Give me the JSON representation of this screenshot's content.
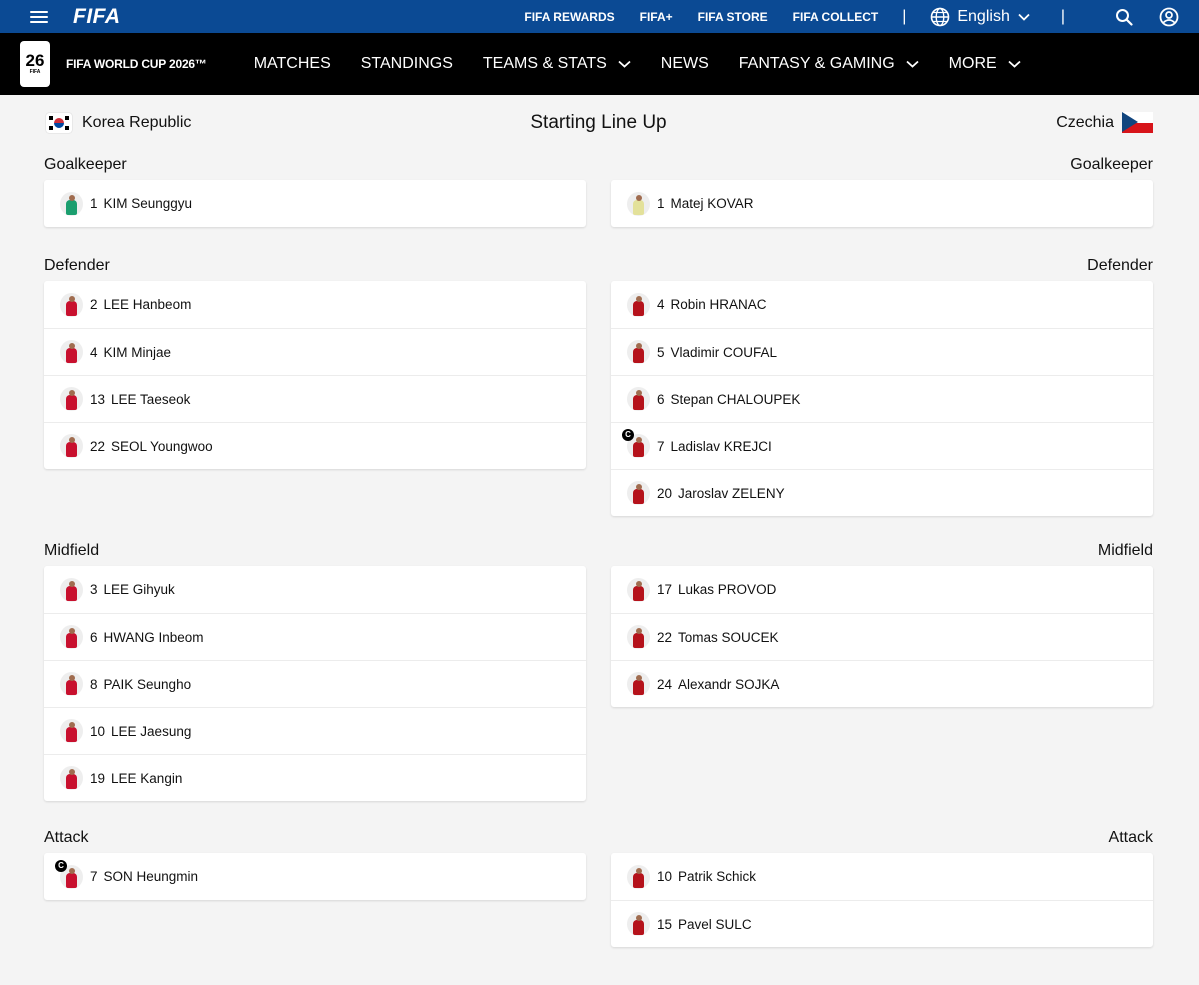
{
  "topbar": {
    "logo": "FIFA",
    "links": [
      "FIFA REWARDS",
      "FIFA+",
      "FIFA STORE",
      "FIFA COLLECT"
    ],
    "separator": "|",
    "language": "English",
    "icons": [
      "menu-icon",
      "globe-icon",
      "chevron-down-icon",
      "search-icon",
      "user-icon"
    ]
  },
  "navbar": {
    "logo_text": "FIFA WORLD CUP 2026™",
    "logo_num": "26",
    "logo_tag": "FIFA",
    "items": [
      {
        "label": "MATCHES",
        "dropdown": false
      },
      {
        "label": "STANDINGS",
        "dropdown": false
      },
      {
        "label": "TEAMS & STATS",
        "dropdown": true
      },
      {
        "label": "NEWS",
        "dropdown": false
      },
      {
        "label": "FANTASY & GAMING",
        "dropdown": true
      },
      {
        "label": "MORE",
        "dropdown": true
      }
    ]
  },
  "lineup": {
    "title": "Starting Line Up",
    "home_team": "Korea Republic",
    "away_team": "Czechia",
    "captain_badge": "C",
    "home_color": "#c8102e",
    "away_color": "#b5121b",
    "home_gk_color": "#1a9e6e",
    "away_gk_color": "#e3e19a",
    "sections": [
      {
        "label": "Goalkeeper",
        "home": [
          {
            "num": "1",
            "name": "KIM Seunggyu",
            "captain": false
          }
        ],
        "away": [
          {
            "num": "1",
            "name": "Matej KOVAR",
            "captain": false
          }
        ]
      },
      {
        "label": "Defender",
        "home": [
          {
            "num": "2",
            "name": "LEE Hanbeom",
            "captain": false
          },
          {
            "num": "4",
            "name": "KIM Minjae",
            "captain": false
          },
          {
            "num": "13",
            "name": "LEE Taeseok",
            "captain": false
          },
          {
            "num": "22",
            "name": "SEOL Youngwoo",
            "captain": false
          }
        ],
        "away": [
          {
            "num": "4",
            "name": "Robin HRANAC",
            "captain": false
          },
          {
            "num": "5",
            "name": "Vladimir COUFAL",
            "captain": false
          },
          {
            "num": "6",
            "name": "Stepan CHALOUPEK",
            "captain": false
          },
          {
            "num": "7",
            "name": "Ladislav KREJCI",
            "captain": true
          },
          {
            "num": "20",
            "name": "Jaroslav ZELENY",
            "captain": false
          }
        ]
      },
      {
        "label": "Midfield",
        "home": [
          {
            "num": "3",
            "name": "LEE Gihyuk",
            "captain": false
          },
          {
            "num": "6",
            "name": "HWANG Inbeom",
            "captain": false
          },
          {
            "num": "8",
            "name": "PAIK Seungho",
            "captain": false
          },
          {
            "num": "10",
            "name": "LEE Jaesung",
            "captain": false
          },
          {
            "num": "19",
            "name": "LEE Kangin",
            "captain": false
          }
        ],
        "away": [
          {
            "num": "17",
            "name": "Lukas PROVOD",
            "captain": false
          },
          {
            "num": "22",
            "name": "Tomas SOUCEK",
            "captain": false
          },
          {
            "num": "24",
            "name": "Alexandr SOJKA",
            "captain": false
          }
        ]
      },
      {
        "label": "Attack",
        "home": [
          {
            "num": "7",
            "name": "SON Heungmin",
            "captain": true
          }
        ],
        "away": [
          {
            "num": "10",
            "name": "Patrik Schick",
            "captain": false
          },
          {
            "num": "15",
            "name": "Pavel SULC",
            "captain": false
          }
        ]
      }
    ]
  }
}
